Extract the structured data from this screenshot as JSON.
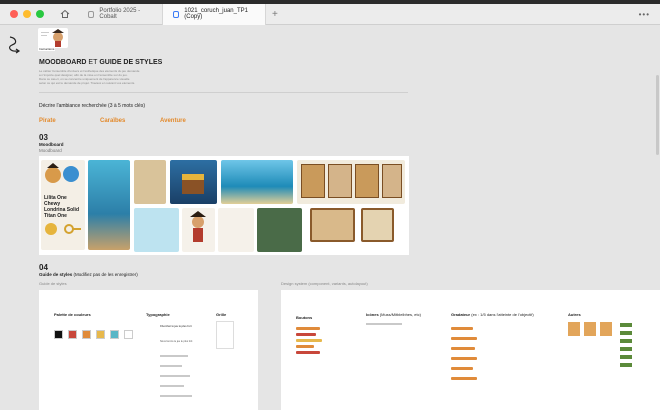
{
  "window": {
    "tabs": [
      {
        "label": "Portfolio 2025 - Cobalt"
      },
      {
        "label": "1021_coruch_juan_TP1 (Copy)"
      }
    ]
  },
  "header": {
    "avatar_label": "Instructions",
    "title_bold_1": "MOODBOARD",
    "title_light": "ET",
    "title_bold_2": "GUIDE DE STYLES",
    "intro_lines": [
      "Le cahier l'ensemble d'univers et l'esthetique des elements du jeu demande",
      "a n'importe quel designer, afin de la mise en l'ensemble sur du jeu.",
      "Dans ce cas-ci, on se concentre uniquement de l'apparence visuelle",
      "selon ce qui est le demande de projet. Travaux en suivant vos elements."
    ]
  },
  "ambiance": {
    "question": "Décrire l'ambiance recherchée (3 à 5 mots clés)",
    "keywords": [
      "Pirate",
      "Caraïbes",
      "Aventure"
    ]
  },
  "moodboard_section": {
    "number": "03",
    "title": "Moodboard",
    "subtitle": "Moodboard",
    "font_card": [
      "Lilita One",
      "Chewy",
      "Londrina Solid",
      "Titan One"
    ]
  },
  "styleguide_section": {
    "number": "04",
    "title": "Guide de styles",
    "title_note": "(Modifiez pas de les enregistrer)",
    "left_label": "Guide de styles",
    "right_label": "Design system (component, variants, autolayout)",
    "palette": {
      "title": "Palette de couleurs",
      "colors": [
        "#111111",
        "#c8473b",
        "#e08b3a",
        "#e7b84c",
        "#5ab6c6",
        "#ffffff"
      ]
    },
    "typography": {
      "title": "Typographie",
      "samples": [
        "Chercher le jeu le plus fort",
        "Nous ferons le jeu le plus fort"
      ]
    },
    "grid": {
      "title": "Grille"
    },
    "buttons": {
      "title": "Boutons"
    },
    "icons": {
      "title": "Icônes",
      "note": "(Muss/Mitbleibhes, etc)"
    },
    "gradients": {
      "title": "Gradateur",
      "note": "(ex : 1/5 dans l'atteinte de l'objectif)"
    },
    "others": {
      "title": "Autres"
    }
  },
  "colors": {
    "accent_orange": "#e38a2c",
    "background": "#e5e5e5"
  }
}
